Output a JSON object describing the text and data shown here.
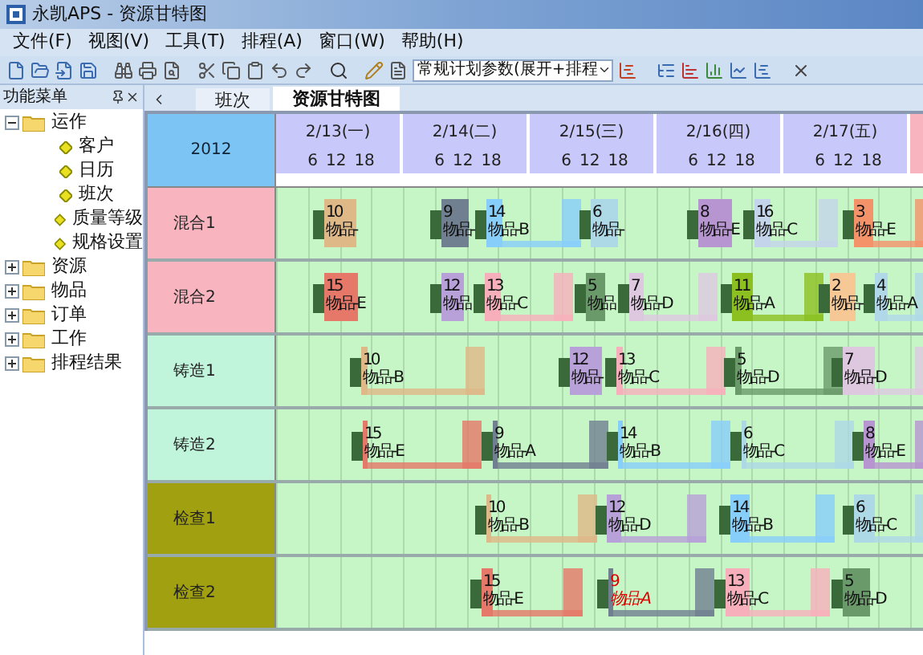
{
  "window": {
    "title": "永凯APS - 资源甘特图"
  },
  "menu": [
    "文件(F)",
    "视图(V)",
    "工具(T)",
    "排程(A)",
    "窗口(W)",
    "帮助(H)"
  ],
  "toolbar": {
    "combo_value": "常规计划参数(展开+排程"
  },
  "side_panel": {
    "title": "功能菜单",
    "tree": [
      {
        "label": "运作",
        "expanded": true,
        "children": [
          {
            "label": "客户"
          },
          {
            "label": "日历"
          },
          {
            "label": "班次"
          },
          {
            "label": "质量等级"
          },
          {
            "label": "规格设置"
          }
        ]
      },
      {
        "label": "资源",
        "expanded": false
      },
      {
        "label": "物品",
        "expanded": false
      },
      {
        "label": "订单",
        "expanded": false
      },
      {
        "label": "工作",
        "expanded": false
      },
      {
        "label": "排程结果",
        "expanded": false
      }
    ]
  },
  "tabs": [
    {
      "label": "班次",
      "selected": false
    },
    {
      "label": "资源甘特图",
      "selected": true
    }
  ],
  "gantt": {
    "year": "2012",
    "days": [
      {
        "label": "2/13(一)",
        "ticks": [
          "6",
          "12",
          "18"
        ]
      },
      {
        "label": "2/14(二)",
        "ticks": [
          "6",
          "12",
          "18"
        ]
      },
      {
        "label": "2/15(三)",
        "ticks": [
          "6",
          "12",
          "18"
        ]
      },
      {
        "label": "2/16(四)",
        "ticks": [
          "6",
          "12",
          "18"
        ]
      },
      {
        "label": "2/17(五)",
        "ticks": [
          "6",
          "12",
          "18"
        ]
      }
    ],
    "rows": [
      {
        "name": "混合1",
        "color": "#f8b4bf",
        "tasks": [
          {
            "number": "10",
            "label": "物品-",
            "color": "#deb887",
            "warning": false
          },
          {
            "number": "9",
            "label": "物品-",
            "color": "#708090",
            "warning": false
          },
          {
            "number": "14",
            "label": "物品-B",
            "color": "#87cefa",
            "warning": false
          },
          {
            "number": "6",
            "label": "物品-",
            "color": "#add8e6",
            "warning": false
          },
          {
            "number": "8",
            "label": "物品-E",
            "color": "#b795d0",
            "warning": false
          },
          {
            "number": "16",
            "label": "物品-C",
            "color": "#c4d4ea",
            "warning": false
          },
          {
            "number": "3",
            "label": "物品-E",
            "color": "#f4926a",
            "warning": false
          }
        ]
      },
      {
        "name": "混合2",
        "color": "#f8b4bf",
        "tasks": [
          {
            "number": "15",
            "label": "物品-E",
            "color": "#e57868",
            "warning": false
          },
          {
            "number": "12",
            "label": "物品",
            "color": "#b8a0d8",
            "warning": false
          },
          {
            "number": "13",
            "label": "物品-C",
            "color": "#f7b0bb",
            "warning": false
          },
          {
            "number": "5",
            "label": "物品",
            "color": "#6a9a6a",
            "warning": false
          },
          {
            "number": "7",
            "label": "物品-D",
            "color": "#ddc8e0",
            "warning": false
          },
          {
            "number": "11",
            "label": "物品-A",
            "color": "#8cc020",
            "warning": false
          },
          {
            "number": "2",
            "label": "物品-",
            "color": "#f5c896",
            "warning": false
          },
          {
            "number": "4",
            "label": "物品-A",
            "color": "#b0d8e8",
            "warning": false
          }
        ]
      },
      {
        "name": "铸造1",
        "color": "#c0f5dc",
        "tasks": [
          {
            "number": "10",
            "label": "物品-B",
            "color": "#deb887",
            "warning": false
          },
          {
            "number": "12",
            "label": "物品-",
            "color": "#b8a0d8",
            "warning": false
          },
          {
            "number": "13",
            "label": "物品-C",
            "color": "#f7b0bb",
            "warning": false
          },
          {
            "number": "5",
            "label": "物品-D",
            "color": "#6a9a6a",
            "warning": false
          },
          {
            "number": "7",
            "label": "物品-D",
            "color": "#ddc8e0",
            "warning": false
          }
        ]
      },
      {
        "name": "铸造2",
        "color": "#c0f5dc",
        "tasks": [
          {
            "number": "15",
            "label": "物品-E",
            "color": "#e57868",
            "warning": false
          },
          {
            "number": "9",
            "label": "物品-A",
            "color": "#708090",
            "warning": false
          },
          {
            "number": "14",
            "label": "物品-B",
            "color": "#87cefa",
            "warning": false
          },
          {
            "number": "6",
            "label": "物品-C",
            "color": "#add8e6",
            "warning": false
          },
          {
            "number": "8",
            "label": "物品-E",
            "color": "#b795d0",
            "warning": false
          }
        ]
      },
      {
        "name": "检查1",
        "color": "#a0a010",
        "tasks": [
          {
            "number": "10",
            "label": "物品-B",
            "color": "#deb887",
            "warning": false
          },
          {
            "number": "12",
            "label": "物品-D",
            "color": "#b8a0d8",
            "warning": false
          },
          {
            "number": "14",
            "label": "物品-B",
            "color": "#87cefa",
            "warning": false
          },
          {
            "number": "6",
            "label": "物品-C",
            "color": "#add8e6",
            "warning": false
          }
        ]
      },
      {
        "name": "检查2",
        "color": "#a0a010",
        "tasks": [
          {
            "number": "15",
            "label": "物品-E",
            "color": "#e57868",
            "warning": false
          },
          {
            "number": "9",
            "label": "物品-A",
            "color": "#708090",
            "warning": true
          },
          {
            "number": "13",
            "label": "物品-C",
            "color": "#f7b0bb",
            "warning": false
          },
          {
            "number": "5",
            "label": "物品-D",
            "color": "#6a9a6a",
            "warning": false
          }
        ]
      }
    ]
  }
}
